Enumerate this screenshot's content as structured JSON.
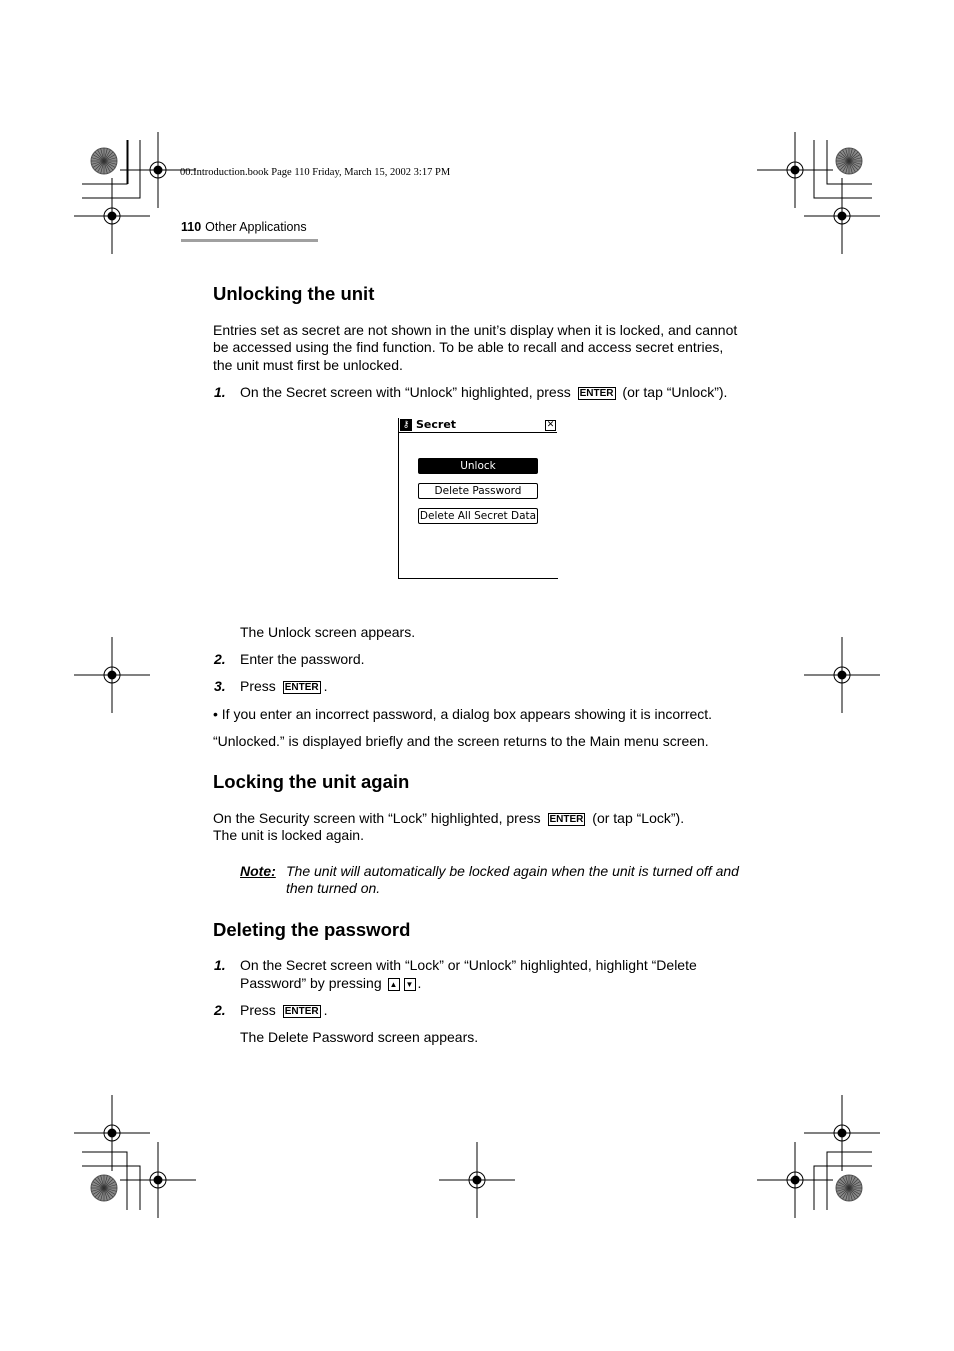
{
  "header": {
    "file_info": "00.Introduction.book  Page 110  Friday, March 15, 2002  3:17 PM",
    "page_number": "110",
    "section": "Other Applications"
  },
  "unlock": {
    "heading": "Unlocking the unit",
    "para": [
      "Entries set as secret are not shown in the unit’s display when it is locked, and cannot",
      "be accessed using the find function. To be able to recall and access secret entries,",
      "the unit must first be unlocked."
    ],
    "step1_num": "1.",
    "step1_a": "On the Secret screen with “Unlock” highlighted, press",
    "step1_key": "ENTER",
    "step1_b": "(or tap “Unlock”).",
    "screen": {
      "title": "Secret",
      "buttons": [
        "Unlock",
        "Delete Password",
        "Delete All Secret Data"
      ],
      "selected": "Unlock"
    },
    "after": "The Unlock screen appears.",
    "step2_num": "2.",
    "step2": "Enter the password.",
    "step3_num": "3.",
    "step3": "Press",
    "step3_key": "ENTER",
    "bullet": "•  If you enter an incorrect password, a dialog box appears showing it is incorrect.",
    "result": "“Unlocked.” is displayed briefly and the screen returns to the Main menu screen."
  },
  "lock": {
    "heading": "Locking the unit again",
    "line1_a": "On the Security screen with “Lock” highlighted, press",
    "line1_key": "ENTER",
    "line1_b": "(or tap “Lock”).",
    "line2": "The unit is locked again.",
    "note_label": "Note:",
    "note": [
      "The unit will automatically be locked again when the unit is turned off and",
      "then turned on."
    ]
  },
  "delete": {
    "heading": "Deleting the password",
    "step1_num": "1.",
    "step1_l1": "On the Secret screen with “Lock” or “Unlock” highlighted, highlight “Delete",
    "step1_l2": "Password” by pressing",
    "up_key": "▲",
    "down_key": "▼",
    "step2_num": "2.",
    "step2": "Press",
    "step2_key": "ENTER",
    "after": "The Delete Password screen appears."
  }
}
